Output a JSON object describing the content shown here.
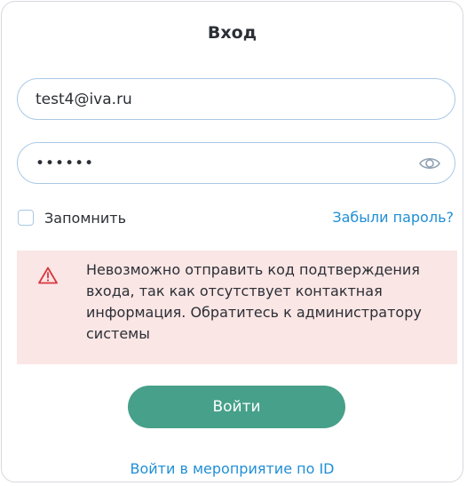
{
  "login": {
    "title": "Вход",
    "email_value": "test4@iva.ru",
    "password_value": "••••••",
    "remember_label": "Запомнить",
    "forgot_link": "Забыли пароль?",
    "error_message": "Невозможно отправить код подтверждения входа, так как отсутствует контактная информация. Обратитесь к администратору системы",
    "submit_label": "Войти",
    "event_link": "Войти в мероприятие по ID"
  },
  "icons": {
    "password_toggle": "eye-icon",
    "error": "warning-triangle-icon"
  },
  "colors": {
    "accent_button": "#47a08a",
    "link": "#1f8fd6",
    "error_bg": "#fae6e5",
    "error_icon": "#d9363e",
    "field_border": "#a9c8e6"
  }
}
